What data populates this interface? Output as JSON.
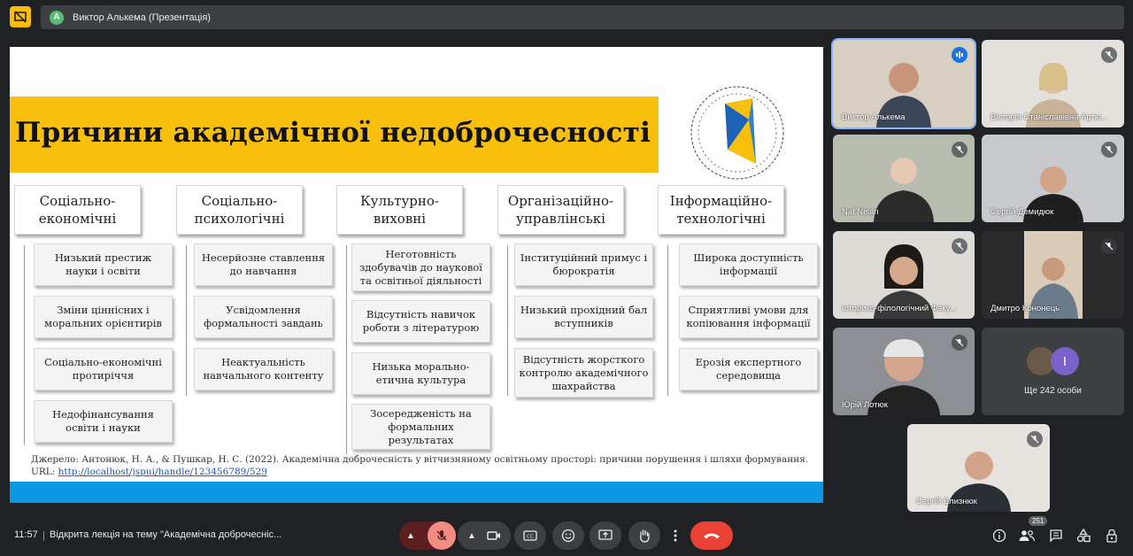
{
  "presenter_bar": {
    "avatar_letter": "A",
    "name": "Виктор Алькема (Презентація)"
  },
  "slide": {
    "title": "Причини академічної недоброчесності",
    "categories": [
      {
        "label": "Соціально-економічні",
        "items": [
          "Низький престиж науки і освіти",
          "Зміни ціннісних і моральних орієнтирів",
          "Соціально-економічні протиріччя",
          "Недофінансування освіти і науки"
        ]
      },
      {
        "label": "Соціально-психологічні",
        "items": [
          "Несерйозне ставлення до навчання",
          "Усвідомлення формальності завдань",
          "Неактуальність навчального контенту"
        ]
      },
      {
        "label": "Культурно-виховні",
        "items": [
          "Неготовність здобувачів до наукової та освітньої діяльності",
          "Відсутність навичок роботи з літературою",
          "Низька морально-етична культура",
          "Зосередженість на формальних результатах"
        ]
      },
      {
        "label": "Організаційно-управлінські",
        "items": [
          "Інституційний примус і бюрократія",
          "Низький прохідний бал вступників",
          "Відсутність жорсткого контролю академічного шахрайства"
        ]
      },
      {
        "label": "Інформаційно-технологічні",
        "items": [
          "Широка доступність інформації",
          "Сприятливі умови для копіювання інформації",
          "Ерозія експертного середовища"
        ]
      }
    ],
    "source_text": "Джерело: Антонюк, Н. А., & Пушкар, Н. С. (2022). Академічна доброчесність у вітчизняному освітньому просторі: причини порушення і шляхи формування.",
    "url_label": "URL:",
    "url": "http://localhost/jspui/handle/123456789/529"
  },
  "participants": [
    {
      "name": "Виктор Алькема"
    },
    {
      "name": "Вікторія Станіславівна Артю..."
    },
    {
      "name": "Nat Nisan"
    },
    {
      "name": "Сергій Демидюк"
    },
    {
      "name": "Історико-філологічний Факу..."
    },
    {
      "name": "Дмитро Кононець"
    },
    {
      "name": "Юрій Лотюк"
    },
    {
      "name": "Ще 242 особи",
      "avatar_letter": "І"
    },
    {
      "name": "Сергій Близнюк"
    }
  ],
  "bottom_bar": {
    "time": "11:57",
    "meeting_title": "Відкрита лекція на тему \"Академічна доброчесніс...",
    "participants_count": "251"
  },
  "colors": {
    "slide_title_bar": "#f8bf0c",
    "slide_bottom_bar": "#0a96e0",
    "hangup": "#ea4335",
    "speaking": "#1a73e8"
  }
}
